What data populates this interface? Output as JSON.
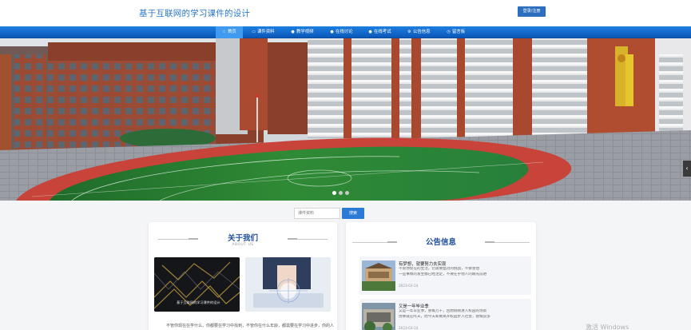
{
  "header": {
    "site_title": "基于互联网的学习课件的设计",
    "login_button": "登录/注册"
  },
  "nav": {
    "items": [
      {
        "label": "首页",
        "icon": "home-icon"
      },
      {
        "label": "课件资料",
        "icon": "folder-icon"
      },
      {
        "label": "教学视频",
        "icon": "circle-icon"
      },
      {
        "label": "在线讨论",
        "icon": "circle-icon"
      },
      {
        "label": "在线考试",
        "icon": "circle-icon"
      },
      {
        "label": "公告信息",
        "icon": "gear-icon"
      },
      {
        "label": "留言板",
        "icon": "clock-icon"
      }
    ],
    "active_index": 0,
    "bar_color": "#0b66cf"
  },
  "banner": {
    "active_slide": 1,
    "slide_count": 3
  },
  "search": {
    "placeholder": "课件资料",
    "button_label": "搜索"
  },
  "about": {
    "title": "关于我们",
    "subtitle": "ABOUT US",
    "image1_caption": "基于互联网的学习课件的设计",
    "text": "不管你现在在学什么，你都要在学习中找到，不管你在什么年龄，都需要在学习中进步，你的人生才能更精彩"
  },
  "notice": {
    "title": "公告信息",
    "items": [
      {
        "title": "有梦想，就要努力去实现",
        "lines": [
          "不管你现在的生活，仍需要面对的挑战，不要害怕",
          "一些事情的发生都已经注定，不要在乎他人的眼光前进"
        ],
        "date": "2023-03-14"
      },
      {
        "title": "又是一年毕业季",
        "lines": [
          "又是一年毕业季，感慨万千，回想刚刚进入校园的场景",
          "仿佛就在昨天，而今天却要离开校园步入社会，感慨良多"
        ],
        "date": "2023-03-14"
      }
    ]
  },
  "system": {
    "watermark": "激活 Windows"
  }
}
